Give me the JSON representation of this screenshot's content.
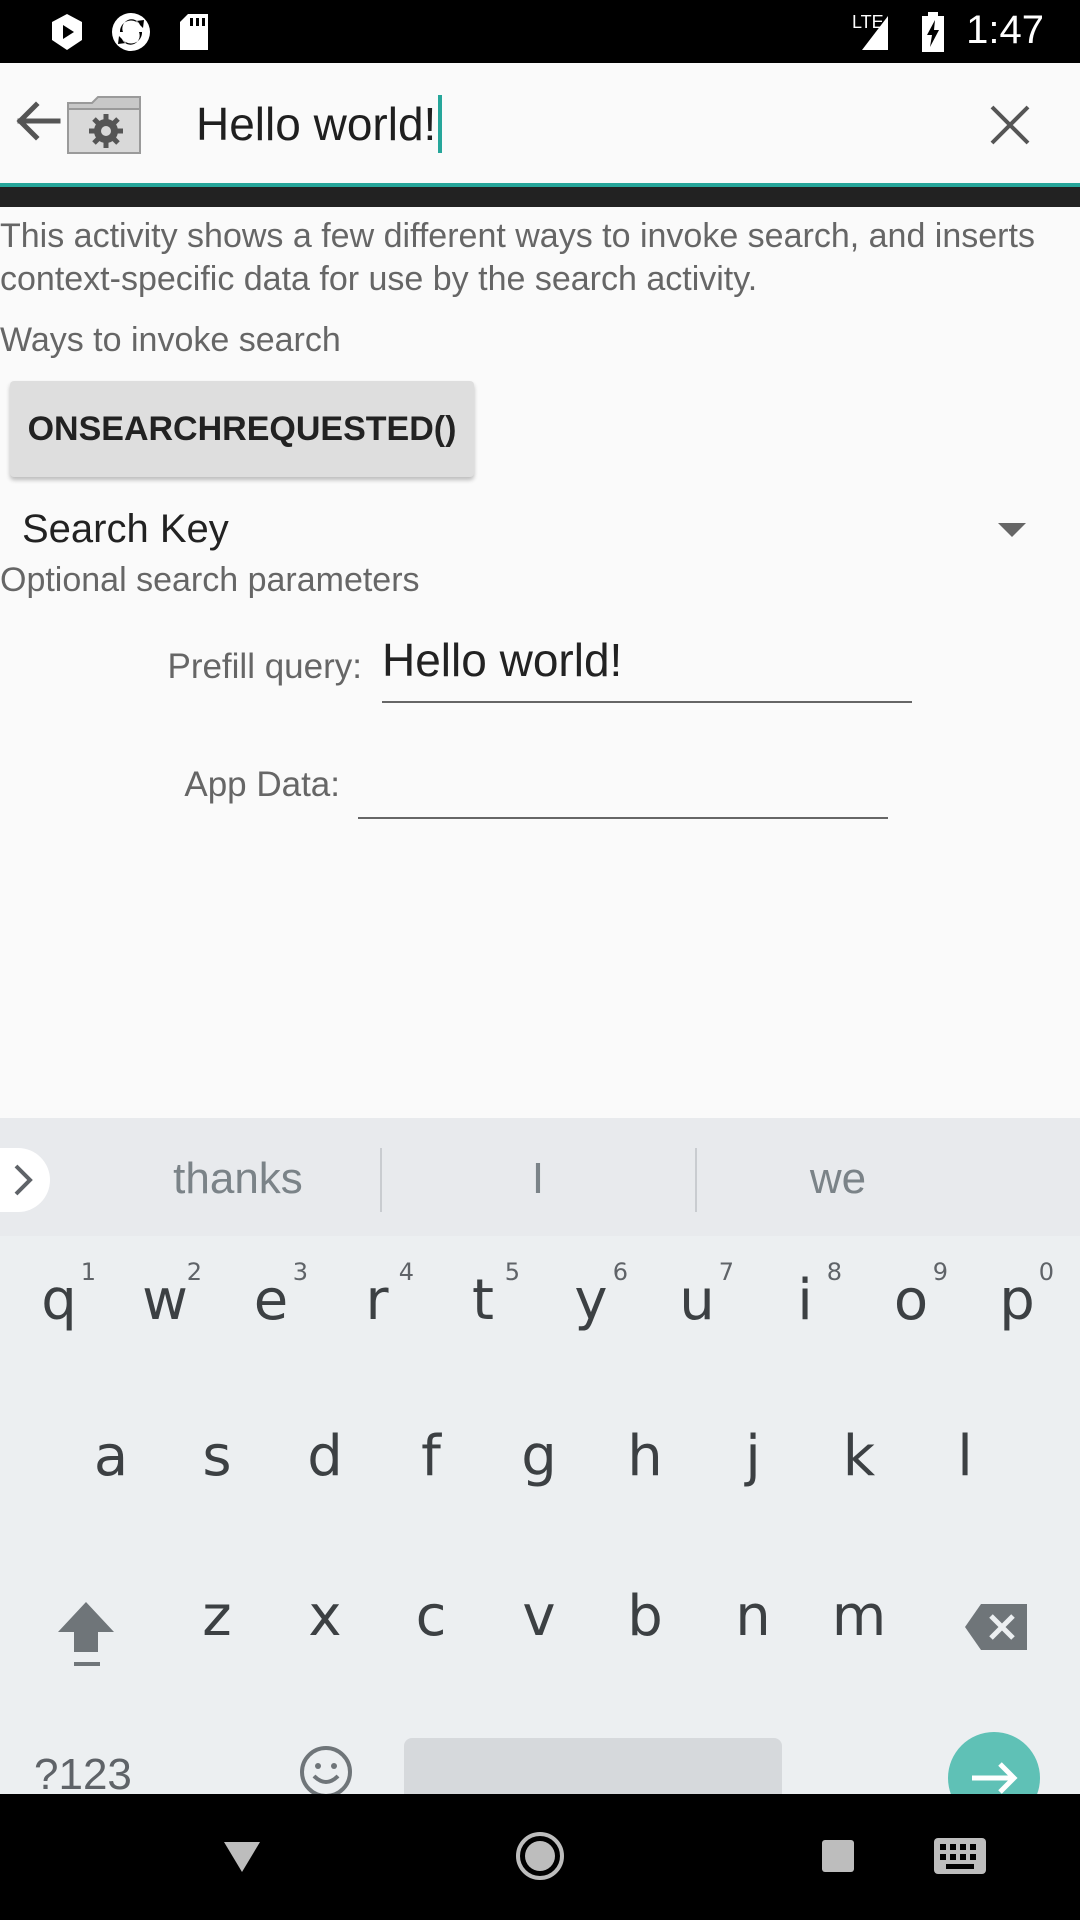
{
  "status_bar": {
    "time": "1:47",
    "network_label": "LTE",
    "icons": [
      "play-store-icon",
      "sync-icon",
      "sd-card-icon",
      "signal-icon",
      "battery-charging-icon"
    ]
  },
  "search": {
    "query": "Hello world!",
    "back_icon": "arrow-back-icon",
    "app_icon": "settings-folder-icon",
    "clear_icon": "close-icon"
  },
  "content": {
    "intro": "This activity shows a few different ways to invoke search, and inserts context-specific data for use by the search activity.",
    "ways_label": "Ways to invoke search",
    "onsearch_button": "ONSEARCHREQUESTED()",
    "spinner_value": "Search Key",
    "optional_label": "Optional search parameters",
    "prefill_label": "Prefill query:",
    "prefill_value": "Hello world!",
    "appdata_label": "App Data:",
    "appdata_value": ""
  },
  "keyboard": {
    "suggestions": [
      "thanks",
      "I",
      "we"
    ],
    "row1": [
      {
        "ch": "q",
        "num": "1"
      },
      {
        "ch": "w",
        "num": "2"
      },
      {
        "ch": "e",
        "num": "3"
      },
      {
        "ch": "r",
        "num": "4"
      },
      {
        "ch": "t",
        "num": "5"
      },
      {
        "ch": "y",
        "num": "6"
      },
      {
        "ch": "u",
        "num": "7"
      },
      {
        "ch": "i",
        "num": "8"
      },
      {
        "ch": "o",
        "num": "9"
      },
      {
        "ch": "p",
        "num": "0"
      }
    ],
    "row2": [
      "a",
      "s",
      "d",
      "f",
      "g",
      "h",
      "j",
      "k",
      "l"
    ],
    "row3": [
      "z",
      "x",
      "c",
      "v",
      "b",
      "n",
      "m"
    ],
    "symbols_key": "?123",
    "accent_color": "#26a69a"
  },
  "nav_bar": {
    "icons": [
      "back-triangle-icon",
      "home-circle-icon",
      "recents-square-icon",
      "keyboard-icon"
    ]
  }
}
